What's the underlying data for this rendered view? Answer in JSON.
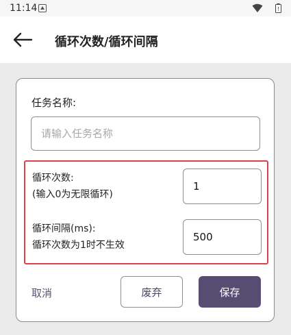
{
  "status_bar": {
    "time": "11:14",
    "notification_icon": "a-notification-icon",
    "wifi_icon": "wifi-icon",
    "battery_icon": "battery-icon"
  },
  "app_bar": {
    "back_icon": "arrow-left-icon",
    "title": "循环次数/循环间隔"
  },
  "form": {
    "task_name": {
      "label": "任务名称:",
      "placeholder": "请输入任务名称",
      "value": ""
    },
    "loop_count": {
      "label_line1": "循环次数:",
      "label_line2": "(输入0为无限循环)",
      "value": "1"
    },
    "loop_interval": {
      "label_line1": "循环间隔(ms):",
      "label_line2": "循环次数为1时不生效",
      "value": "500"
    },
    "highlight_color": "#d9424a"
  },
  "actions": {
    "cancel_label": "取消",
    "discard_label": "废弃",
    "save_label": "保存",
    "primary_color": "#574d73"
  }
}
